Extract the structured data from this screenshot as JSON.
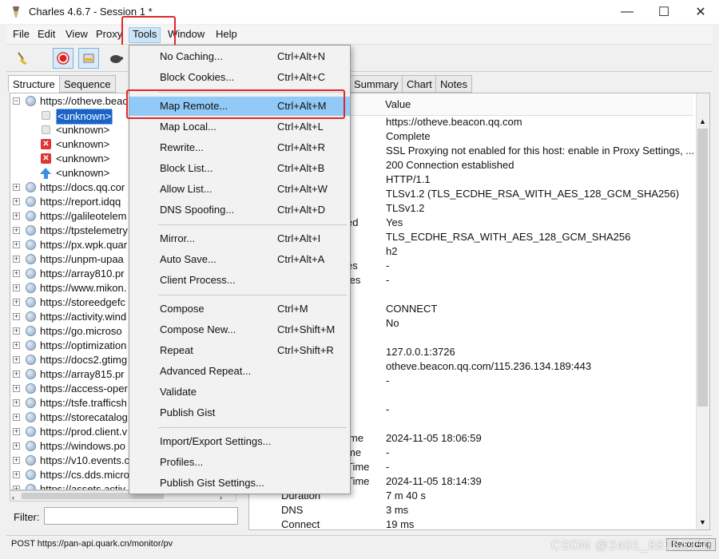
{
  "window": {
    "title": "Charles 4.6.7 - Session 1 *",
    "minimize": "—",
    "maximize": "☐",
    "close": "✕"
  },
  "menubar": [
    "File",
    "Edit",
    "View",
    "Proxy",
    "Tools",
    "Window",
    "Help"
  ],
  "toolbar": {
    "icons": [
      "broom-icon",
      "record-icon",
      "throttle-icon",
      "turtle-icon"
    ]
  },
  "left_tabs": [
    "Structure",
    "Sequence"
  ],
  "tree": [
    {
      "type": "host",
      "label": "https://otheve.beac",
      "expanded": true
    },
    {
      "type": "child-lock",
      "label": "<unknown>",
      "selected": true
    },
    {
      "type": "child-lock",
      "label": "<unknown>"
    },
    {
      "type": "child-error",
      "label": "<unknown>"
    },
    {
      "type": "child-error",
      "label": "<unknown>"
    },
    {
      "type": "child-upload",
      "label": "<unknown>"
    },
    {
      "type": "host",
      "label": "https://docs.qq.cor"
    },
    {
      "type": "host",
      "label": "https://report.idqq"
    },
    {
      "type": "host",
      "label": "https://galileotelem"
    },
    {
      "type": "host",
      "label": "https://tpstelemetry"
    },
    {
      "type": "host",
      "label": "https://px.wpk.quar"
    },
    {
      "type": "host",
      "label": "https://unpm-upaa"
    },
    {
      "type": "host",
      "label": "https://array810.pr"
    },
    {
      "type": "host",
      "label": "https://www.mikon."
    },
    {
      "type": "host",
      "label": "https://storeedgefc"
    },
    {
      "type": "host",
      "label": "https://activity.wind"
    },
    {
      "type": "host",
      "label": "https://go.microso"
    },
    {
      "type": "host",
      "label": "https://optimization"
    },
    {
      "type": "host",
      "label": "https://docs2.gtimg"
    },
    {
      "type": "host",
      "label": "https://array815.pr"
    },
    {
      "type": "host",
      "label": "https://access-oper"
    },
    {
      "type": "host",
      "label": "https://tsfe.trafficsh"
    },
    {
      "type": "host",
      "label": "https://storecatalog"
    },
    {
      "type": "host",
      "label": "https://prod.client.v"
    },
    {
      "type": "host",
      "label": "https://windows.po"
    },
    {
      "type": "host",
      "label": "https://v10.events.c"
    },
    {
      "type": "host",
      "label": "https://cs.dds.micro"
    },
    {
      "type": "host",
      "label": "https://assets.activ"
    }
  ],
  "filter": {
    "label": "Filter:",
    "value": ""
  },
  "right_tabs": [
    "Summary",
    "Chart",
    "Notes"
  ],
  "detail": {
    "value_header": "Value",
    "rows": [
      {
        "name": "",
        "value": "https://otheve.beacon.qq.com"
      },
      {
        "name": "",
        "value": "Complete"
      },
      {
        "name": "",
        "value": "SSL Proxying not enabled for this host: enable in Proxy Settings, ..."
      },
      {
        "name": "",
        "value": "200 Connection established"
      },
      {
        "name": "",
        "value": "HTTP/1.1"
      },
      {
        "name": "",
        "value": "TLSv1.2 (TLS_ECDHE_RSA_WITH_AES_128_GCM_SHA256)"
      },
      {
        "name": "",
        "value": "TLSv1.2"
      },
      {
        "name": "ed",
        "value": "Yes"
      },
      {
        "name": "",
        "value": "TLS_ECDHE_RSA_WITH_AES_128_GCM_SHA256"
      },
      {
        "name": "",
        "value": "h2"
      },
      {
        "name": "es",
        "value": "-"
      },
      {
        "name": "tes",
        "value": "-"
      },
      {
        "name": "",
        "value": ""
      },
      {
        "name": "",
        "value": "CONNECT"
      },
      {
        "name": "",
        "value": "No"
      },
      {
        "name": "",
        "value": ""
      },
      {
        "name": "",
        "value": "127.0.0.1:3726"
      },
      {
        "name": "",
        "value": "otheve.beacon.qq.com/115.236.134.189:443"
      },
      {
        "name": "",
        "value": "-"
      },
      {
        "name": "",
        "value": ""
      },
      {
        "name": "",
        "value": "-"
      },
      {
        "name": "",
        "value": ""
      },
      {
        "name": "ime",
        "value": "2024-11-05 18:06:59"
      },
      {
        "name": "me",
        "value": "-"
      },
      {
        "name": "Time",
        "value": "-"
      },
      {
        "name": "Time",
        "value": "2024-11-05 18:14:39"
      },
      {
        "name": "Duration",
        "value": "7 m 40 s"
      },
      {
        "name": "DNS",
        "value": "3 ms"
      },
      {
        "name": "Connect",
        "value": "19 ms"
      }
    ]
  },
  "tools_menu": {
    "items": [
      {
        "label": "No Caching...",
        "shortcut": "Ctrl+Alt+N"
      },
      {
        "label": "Block Cookies...",
        "shortcut": "Ctrl+Alt+C"
      },
      {
        "sep": true
      },
      {
        "label": "Map Remote...",
        "shortcut": "Ctrl+Alt+M",
        "highlighted": true
      },
      {
        "label": "Map Local...",
        "shortcut": "Ctrl+Alt+L"
      },
      {
        "label": "Rewrite...",
        "shortcut": "Ctrl+Alt+R"
      },
      {
        "label": "Block List...",
        "shortcut": "Ctrl+Alt+B"
      },
      {
        "label": "Allow List...",
        "shortcut": "Ctrl+Alt+W"
      },
      {
        "label": "DNS Spoofing...",
        "shortcut": "Ctrl+Alt+D"
      },
      {
        "sep": true
      },
      {
        "label": "Mirror...",
        "shortcut": "Ctrl+Alt+I"
      },
      {
        "label": "Auto Save...",
        "shortcut": "Ctrl+Alt+A"
      },
      {
        "label": "Client Process...",
        "shortcut": ""
      },
      {
        "sep": true
      },
      {
        "label": "Compose",
        "shortcut": "Ctrl+M"
      },
      {
        "label": "Compose New...",
        "shortcut": "Ctrl+Shift+M"
      },
      {
        "label": "Repeat",
        "shortcut": "Ctrl+Shift+R"
      },
      {
        "label": "Advanced Repeat...",
        "shortcut": ""
      },
      {
        "label": "Validate",
        "shortcut": ""
      },
      {
        "label": "Publish Gist",
        "shortcut": ""
      },
      {
        "sep": true
      },
      {
        "label": "Import/Export Settings...",
        "shortcut": ""
      },
      {
        "label": "Profiles...",
        "shortcut": ""
      },
      {
        "label": "Publish Gist Settings...",
        "shortcut": ""
      }
    ]
  },
  "status": {
    "text": "POST https://pan-api.quark.cn/monitor/pv",
    "recording": "Recording"
  },
  "watermark": "CSDN @2401_88754250",
  "colors": {
    "highlight": "#91c9f7",
    "selection": "#1a63c7",
    "annotation_red": "#e0272d"
  }
}
